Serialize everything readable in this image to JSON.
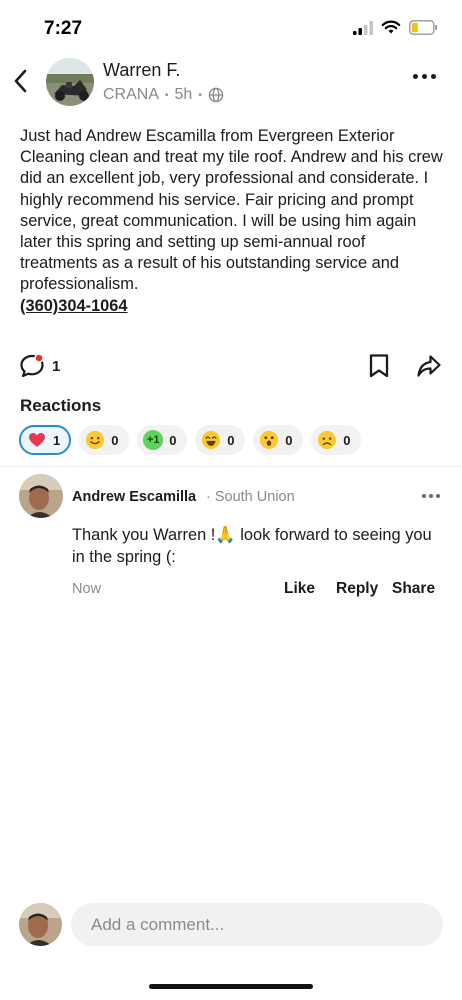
{
  "status_bar": {
    "time": "7:27"
  },
  "post": {
    "author_name": "Warren F.",
    "community": "CRANA",
    "separator": "•",
    "age": "5h",
    "body": "Just had Andrew Escamilla from Evergreen Exterior Cleaning clean and treat my tile roof. Andrew and his crew did an excellent job, very professional and considerate. I highly recommend his service. Fair pricing and prompt service, great communication. I will be using him again later this spring and setting up semi-annual roof treatments as a result of his outstanding service and professionalism.",
    "phone": "(360)304-1064",
    "comment_count": "1"
  },
  "reactions": {
    "title": "Reactions",
    "items": [
      {
        "emoji": "❤️",
        "count": "1",
        "active": true
      },
      {
        "emoji": "🙂",
        "count": "0"
      },
      {
        "emoji": "+1",
        "count": "0"
      },
      {
        "emoji": "😄",
        "count": "0"
      },
      {
        "emoji": "😮",
        "count": "0"
      },
      {
        "emoji": "😟",
        "count": "0"
      }
    ]
  },
  "comment": {
    "author": "Andrew Escamilla",
    "location": "· South Union",
    "text": "Thank you Warren !🙏 look forward to seeing you in the spring (:",
    "time": "Now",
    "like_label": "Like",
    "reply_label": "Reply",
    "share_label": "Share"
  },
  "composer": {
    "placeholder": "Add a comment..."
  },
  "colors": {
    "accent": "#2a8ccf",
    "heart": "#e8384f",
    "notification_dot": "#e5352b",
    "muted": "#8a8a8a"
  }
}
